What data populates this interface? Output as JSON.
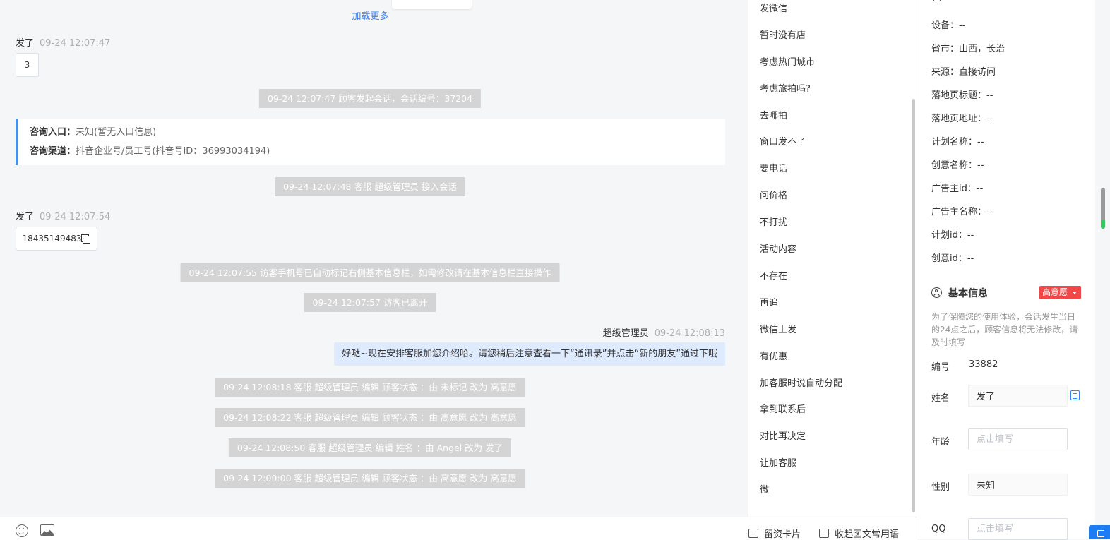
{
  "chat": {
    "load_more": "加载更多",
    "messages": [
      {
        "sender": "发了",
        "time": "09-24 12:07:47",
        "content": "3"
      },
      {
        "sender": "发了",
        "time": "09-24 12:07:54",
        "content": "18435149483"
      }
    ],
    "system": [
      "09-24 12:07:47 顾客发起会话，会话编号：37204",
      "09-24 12:07:48 客服 超级管理员 接入会话",
      "09-24 12:07:55 访客手机号已自动标记右侧基本信息栏，如需修改请在基本信息栏直接操作",
      "09-24 12:07:57 访客已离开",
      "09-24 12:08:18 客服 超级管理员 编辑 顾客状态 ：由 未标记 改为 高意愿",
      "09-24 12:08:22 客服 超级管理员 编辑 顾客状态 ：由 高意愿 改为 高意愿",
      "09-24 12:08:50 客服 超级管理员 编辑 姓名 ：由 Angel 改为 发了",
      "09-24 12:09:00 客服 超级管理员 编辑 顾客状态 ：由 高意愿 改为 高意愿"
    ],
    "entry": {
      "label1": "咨询入口：",
      "value1": "未知(暂无入口信息)",
      "label2": "咨询渠道：",
      "value2": "抖音企业号/员工号(抖音号ID：36993034194)"
    },
    "agent": {
      "name": "超级管理员",
      "time": "09-24 12:08:13",
      "text": "好哒~现在安排客服加您介绍哈。请您稍后注意查看一下“通讯录”并点击“新的朋友”通过下哦"
    }
  },
  "bottom": {
    "card_label": "留资卡片",
    "collapse_label": "收起图文常用语"
  },
  "phrases": [
    "发微信",
    "暂时没有店",
    "考虑热门城市",
    "考虑旅拍吗?",
    "去哪拍",
    "窗口发不了",
    "要电话",
    "问价格",
    "不打扰",
    "活动内容",
    "不存在",
    "再追",
    "微信上发",
    "有优惠",
    "加客服时说自动分配",
    "拿到联系后",
    "对比再决定",
    "让加客服",
    "微"
  ],
  "visitor": {
    "fields": [
      {
        "label": "设备：",
        "value": "--"
      },
      {
        "label": "省市：",
        "value": "山西，长治"
      },
      {
        "label": "来源：",
        "value": "直接访问"
      },
      {
        "label": "落地页标题：",
        "value": "--"
      },
      {
        "label": "落地页地址：",
        "value": "--"
      },
      {
        "label": "计划名称：",
        "value": "--"
      },
      {
        "label": "创意名称：",
        "value": "--"
      },
      {
        "label": "广告主id：",
        "value": "--"
      },
      {
        "label": "广告主名称：",
        "value": "--"
      },
      {
        "label": "计划id：",
        "value": "--"
      },
      {
        "label": "创意id：",
        "value": "--"
      }
    ]
  },
  "basic_info": {
    "title": "基本信息",
    "intent": "高意愿",
    "hint": "为了保障您的使用体验，会话发生当日的24点之后，顾客信息将无法修改，请及时填写",
    "id_label": "编号",
    "id_value": "33882",
    "name_label": "姓名",
    "name_value": "发了",
    "age_label": "年龄",
    "age_placeholder": "点击填写",
    "gender_label": "性别",
    "gender_value": "未知",
    "qq_label": "QQ",
    "qq_placeholder": "点击填写"
  },
  "colors": {
    "accent": "#3b82f6",
    "intent_badge": "#f04848",
    "agent_bubble": "#deeafd",
    "system_bg": "#d4d4d4"
  }
}
